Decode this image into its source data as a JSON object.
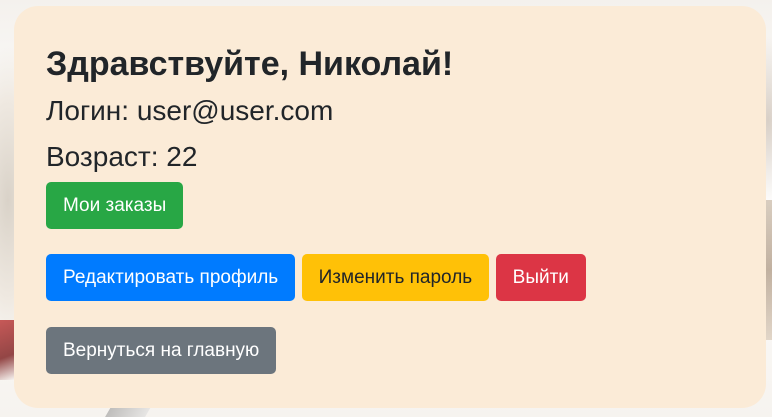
{
  "profile": {
    "greeting": "Здравствуйте, Николай!",
    "login_line": "Логин: user@user.com",
    "age_line": "Возраст: 22"
  },
  "buttons": {
    "orders": "Мои заказы",
    "edit_profile": "Редактировать профиль",
    "change_password": "Изменить пароль",
    "logout": "Выйти",
    "back_home": "Вернуться на главную"
  },
  "colors": {
    "card_background": "#fbebd7",
    "success": "#28a745",
    "primary": "#007bff",
    "warning": "#ffc107",
    "danger": "#dc3545",
    "secondary": "#6c757d"
  }
}
